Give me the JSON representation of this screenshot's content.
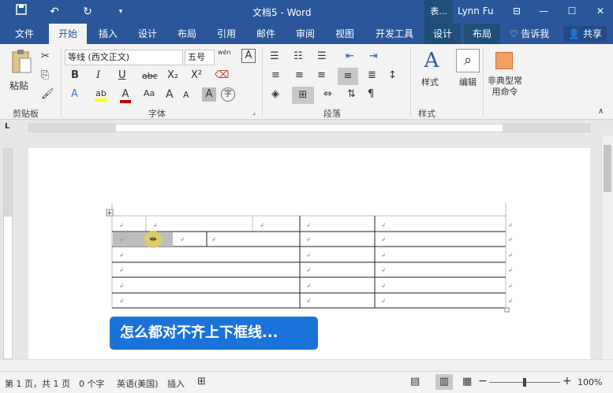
{
  "titlebar": {
    "save_icon": "save-icon",
    "undo_icon": "undo-icon",
    "redo_icon": "redo-icon",
    "customize_icon": "dropdown-icon",
    "title": "文档5 - Word",
    "context_tab": "表...",
    "user": "Lynn Fu",
    "ribbon_options_icon": "ribbon-display-icon",
    "minimize": "—",
    "maximize": "☐",
    "close": "✕"
  },
  "tabs": [
    "文件",
    "开始",
    "插入",
    "设计",
    "布局",
    "引用",
    "邮件",
    "审阅",
    "视图",
    "开发工具",
    "设计",
    "布局"
  ],
  "active_tab": "开始",
  "tell_me": "告诉我",
  "share": "共享",
  "ribbon": {
    "clipboard": {
      "paste": "粘贴",
      "label": "剪贴板"
    },
    "font": {
      "name": "等线 (西文正文)",
      "size": "五号",
      "wen_label": "wén",
      "label": "字体",
      "buttons": [
        "B",
        "I",
        "U",
        "abc",
        "X₂",
        "X²",
        "A",
        "ab",
        "A",
        "Aa",
        "A",
        "A",
        "A",
        "字"
      ]
    },
    "paragraph": {
      "label": "段落"
    },
    "styles": {
      "style_label": "样式",
      "edit_label": "编辑",
      "label": "样式"
    },
    "custom": {
      "label": "非典型常用命令"
    }
  },
  "table": {
    "cell_mark": "↲"
  },
  "caption": "怎么都对不齐上下框线...",
  "status": {
    "page": "第 1 页，共 1 页",
    "words": "0 个字",
    "language": "英语(美国)",
    "insert": "插入",
    "zoom": "100%",
    "zoom_minus": "−",
    "zoom_plus": "+"
  },
  "colors": {
    "brand": "#2b579a",
    "caption_bg": "#1a73d9",
    "highlight": "#ffff00",
    "font_red": "#c00000"
  }
}
